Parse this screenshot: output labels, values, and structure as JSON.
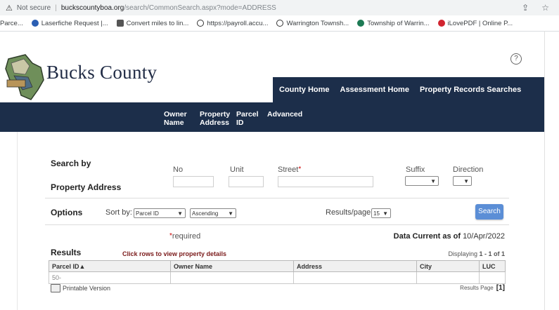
{
  "browser": {
    "security_label": "Not secure",
    "host": "buckscountyboa.org",
    "path": "/search/CommonSearch.aspx?mode=ADDRESS",
    "bookmarks": [
      {
        "label": "Parce...",
        "color": "#4a6fa5"
      },
      {
        "label": "Laserfiche Request |...",
        "color": "#2b5fb3"
      },
      {
        "label": "Convert miles to lin...",
        "color": "#555555"
      },
      {
        "label": "https://payroll.accu...",
        "color": "#333333"
      },
      {
        "label": "Warrington Townsh...",
        "color": "#333333"
      },
      {
        "label": "Township of Warrin...",
        "color": "#1d7a54"
      },
      {
        "label": "iLovePDF | Online P...",
        "color": "#d1242f"
      }
    ]
  },
  "header": {
    "logo_text": "Bucks County",
    "help_symbol": "?",
    "topnav": [
      "County Home",
      "Assessment Home",
      "Property Records Searches"
    ],
    "subnav": [
      {
        "line1": "Owner",
        "line2": "Name"
      },
      {
        "line1": "Property",
        "line2": "Address"
      },
      {
        "line1": "Parcel",
        "line2": "ID"
      },
      {
        "line1": "Advanced",
        "line2": ""
      }
    ]
  },
  "search": {
    "title_line1": "Search by",
    "title_line2": "Property Address",
    "fields": {
      "no_label": "No",
      "unit_label": "Unit",
      "street_label": "Street",
      "required_star": "*",
      "suffix_label": "Suffix",
      "direction_label": "Direction"
    },
    "options_label": "Options",
    "sort_by_label": "Sort by:",
    "sort_by_value": "Parcel ID",
    "sort_order_value": "Ascending",
    "results_per_page_label": "Results/page:",
    "results_per_page_value": "15",
    "search_button": "Search",
    "required_note": "required",
    "data_current_label": "Data Current as of",
    "data_current_date": "10/Apr/2022"
  },
  "results": {
    "label": "Results",
    "click_rows_hint": "Click rows to view property details",
    "displaying_label": "Displaying",
    "displaying_range": "1 - 1 of 1",
    "columns": [
      "Parcel ID▲",
      "Owner Name",
      "Address",
      "City",
      "LUC"
    ],
    "rows": [
      [
        "50-",
        "",
        "",
        "",
        ""
      ]
    ],
    "printable_label": "Printable Version",
    "results_page_label": "Results Page",
    "results_page_value": "[1]"
  },
  "colors": {
    "nav_bg": "#1c2e4a",
    "search_button": "#5b8ed6",
    "hint_text": "#7a1a1a"
  }
}
